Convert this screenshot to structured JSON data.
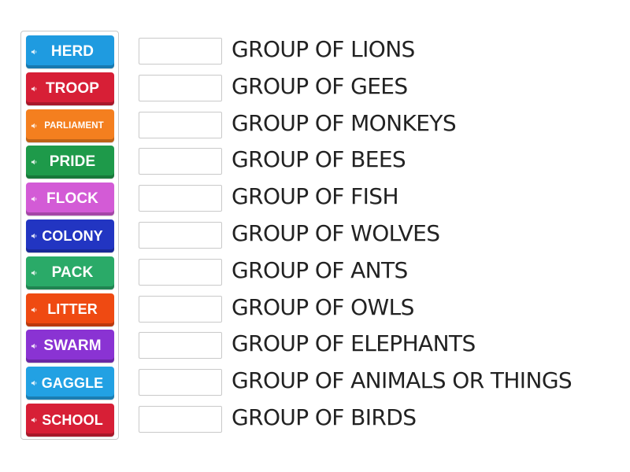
{
  "tiles": [
    {
      "label": "HERD",
      "color": "#1f9be0"
    },
    {
      "label": "TROOP",
      "color": "#d71f36"
    },
    {
      "label": "PARLIAMENT",
      "color": "#f47f1f"
    },
    {
      "label": "PRIDE",
      "color": "#1e9a4a"
    },
    {
      "label": "FLOCK",
      "color": "#d35bd6"
    },
    {
      "label": "COLONY",
      "color": "#2235c2"
    },
    {
      "label": "PACK",
      "color": "#2aaa68"
    },
    {
      "label": "LITTER",
      "color": "#ef4a12"
    },
    {
      "label": "SWARM",
      "color": "#8a33d3"
    },
    {
      "label": "GAGGLE",
      "color": "#22a1e3"
    },
    {
      "label": "SCHOOL",
      "color": "#d71f36"
    }
  ],
  "tile_icon": "speaker-icon",
  "descriptions": [
    "GROUP OF LIONS",
    "GROUP OF GEES",
    "GROUP OF MONKEYS",
    "GROUP OF BEES",
    "GROUP OF FISH",
    "GROUP OF WOLVES",
    "GROUP OF ANTS",
    "GROUP OF OWLS",
    "GROUP OF ELEPHANTS",
    "GROUP OF ANIMALS OR THINGS",
    "GROUP OF BIRDS"
  ]
}
